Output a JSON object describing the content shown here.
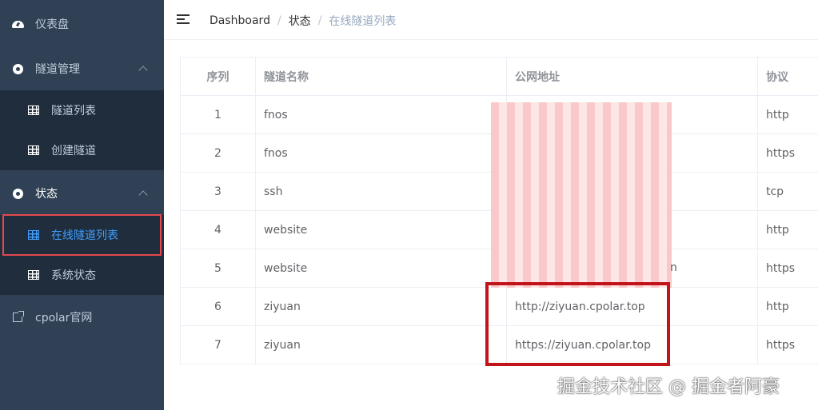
{
  "sidebar": {
    "dashboard": "仪表盘",
    "tunnel_mgmt": "隧道管理",
    "tunnel_list": "隧道列表",
    "create_tunnel": "创建隧道",
    "status": "状态",
    "online_tunnels": "在线隧道列表",
    "system_status": "系统状态",
    "website": "cpolar官网"
  },
  "breadcrumb": {
    "home": "Dashboard",
    "sep": "/",
    "level1": "状态",
    "current": "在线隧道列表"
  },
  "table": {
    "headers": [
      "序列",
      "隧道名称",
      "公网地址",
      "协议"
    ],
    "rows": [
      {
        "index": "1",
        "name": "fnos",
        "url": "",
        "protocol": "http"
      },
      {
        "index": "2",
        "name": "fnos",
        "url": "",
        "protocol": "https"
      },
      {
        "index": "3",
        "name": "ssh",
        "url": "",
        "protocol": "tcp"
      },
      {
        "index": "4",
        "name": "website",
        "url": "",
        "protocol": "http"
      },
      {
        "index": "5",
        "name": "website",
        "url": "",
        "protocol": "https"
      },
      {
        "index": "6",
        "name": "ziyuan",
        "url": "http://ziyuan.cpolar.top",
        "protocol": "http"
      },
      {
        "index": "7",
        "name": "ziyuan",
        "url": "https://ziyuan.cpolar.top",
        "protocol": "https"
      }
    ],
    "redact_tail": "n"
  },
  "watermark": "掘金技术社区 @ 掘金者阿豪",
  "colors": {
    "sidebar_bg": "#304156",
    "submenu_bg": "#1f2d3d",
    "active": "#409eff",
    "highlight": "#c0141a"
  }
}
